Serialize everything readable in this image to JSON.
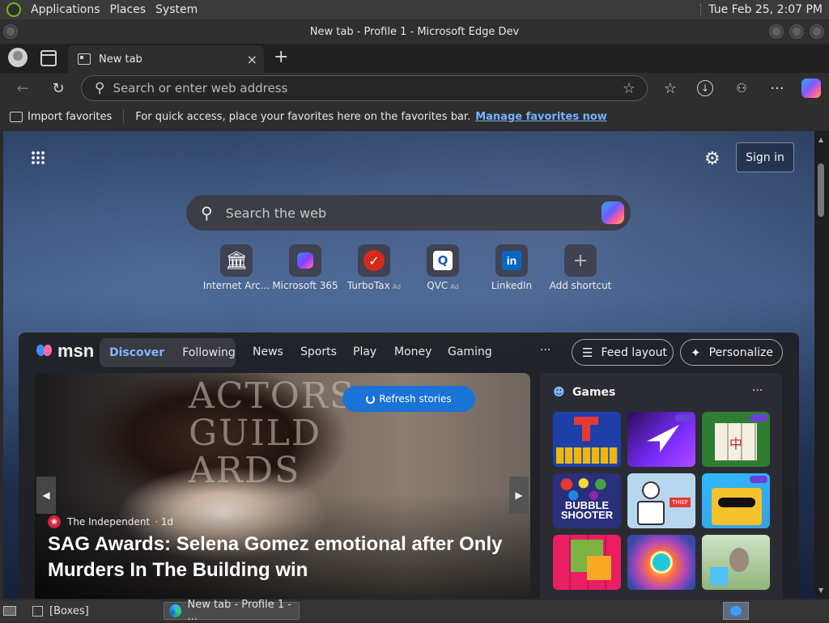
{
  "top_panel": {
    "menus": [
      "Applications",
      "Places",
      "System"
    ],
    "clock": "Tue Feb 25,  2:07 PM"
  },
  "window": {
    "title": "New tab - Profile 1 - Microsoft Edge Dev"
  },
  "tabs": {
    "active_label": "New tab",
    "close_glyph": "×",
    "new_tab_glyph": "+"
  },
  "toolbar": {
    "back_glyph": "←",
    "reload_glyph": "↻",
    "address_placeholder": "Search or enter web address",
    "star_glyph": "☆",
    "favorites_glyph": "☆",
    "more_glyph": "···"
  },
  "favorites_bar": {
    "import_label": "Import favorites",
    "hint": "For quick access, place your favorites here on the favorites bar.",
    "manage_link": "Manage favorites now"
  },
  "newtab": {
    "sign_in": "Sign in",
    "search_placeholder": "Search the web",
    "shortcuts": [
      {
        "label": "Internet Arc...",
        "ad": ""
      },
      {
        "label": "Microsoft 365",
        "ad": ""
      },
      {
        "label": "TurboTax",
        "ad": "Ad"
      },
      {
        "label": "QVC",
        "ad": "Ad"
      },
      {
        "label": "LinkedIn",
        "ad": ""
      },
      {
        "label": "Add shortcut",
        "ad": ""
      }
    ]
  },
  "feed": {
    "brand": "msn",
    "tabs": [
      "Discover",
      "Following"
    ],
    "nav": [
      "News",
      "Sports",
      "Play",
      "Money",
      "Gaming"
    ],
    "more": "···",
    "feed_layout": "Feed layout",
    "personalize": "Personalize",
    "refresh": "Refresh stories",
    "hero": {
      "poster_text": "ACTORS\nGUILD\nARDS",
      "source": "The Independent",
      "age": "· 1d",
      "headline": "SAG Awards: Selena Gomez emotional after Only Murders In The Building win"
    },
    "games": {
      "title": "Games",
      "more": "···",
      "tile_text": "BUBBLE SHOOTER"
    }
  },
  "taskbar": {
    "boxes_label": "[Boxes]",
    "edge_label": "New tab - Profile 1 - ..."
  },
  "colors": {
    "accent_blue": "#1a73d6",
    "link_blue": "#74b3ff",
    "panel_bg": "#3a3a3a"
  }
}
